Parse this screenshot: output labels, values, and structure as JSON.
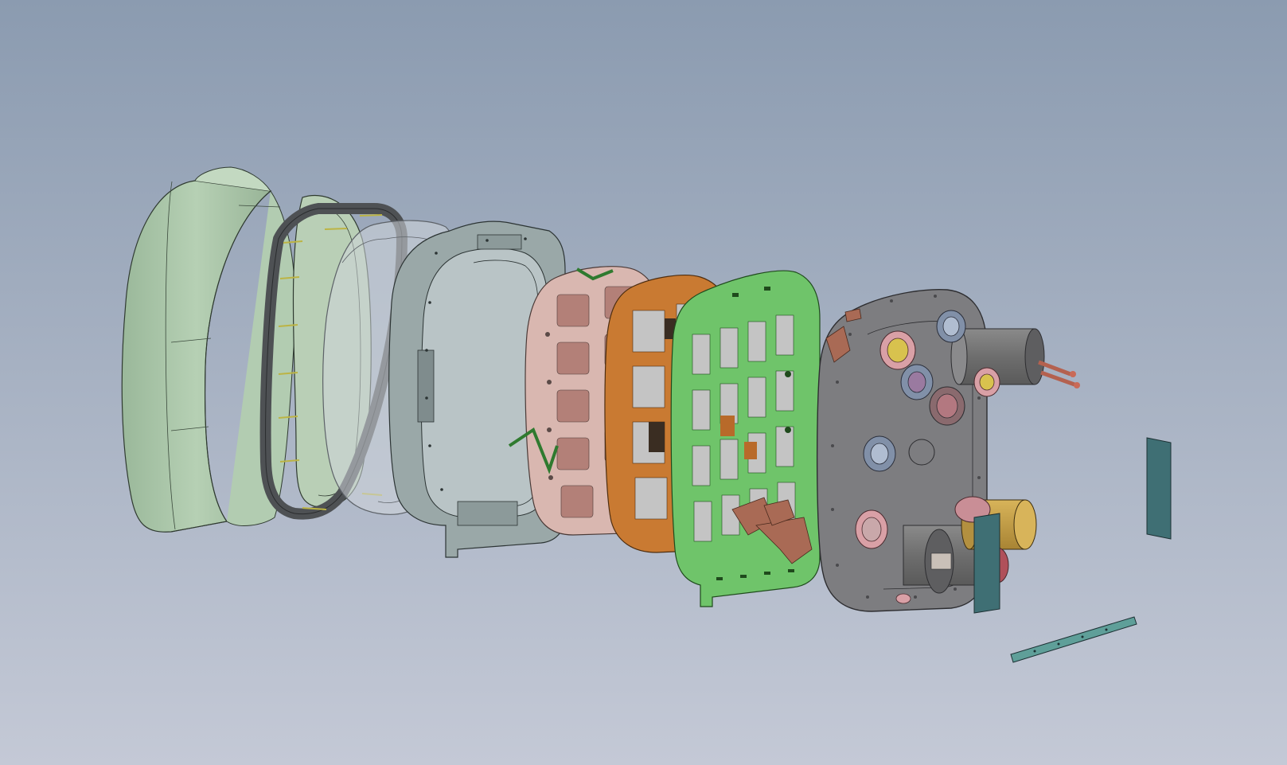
{
  "scene": {
    "kind": "exploded-cad-assembly",
    "view": "isometric",
    "background": {
      "top": "#8b9bb0",
      "bottom": "#c4c9d6"
    },
    "palette": {
      "shell": "#a6c2a6",
      "shell_inner": "#c6dcc4",
      "gasket": "#56595c",
      "clear_ring": "#cfd4d9",
      "frame": "#9aa8a8",
      "pink_plate": "#d9b7b0",
      "copper_frame": "#c97a32",
      "green_board": "#6fc46a",
      "end_plate": "#7d7d80",
      "cylinder_dark": "#737373",
      "cylinder_gold": "#c9a24a",
      "clamp_pink": "#d9a0a6",
      "clamp_blue": "#8190a8",
      "teal_strip": "#3f6f74",
      "teal_flat": "#5f9f99",
      "bolt_yellow": "#c9c24e"
    },
    "parts": [
      {
        "id": "outer-shell",
        "material": "shell"
      },
      {
        "id": "gasket-ring",
        "material": "gasket"
      },
      {
        "id": "transparent-ring",
        "material": "clear_ring"
      },
      {
        "id": "mounting-frame",
        "material": "frame"
      },
      {
        "id": "pink-plate",
        "material": "pink_plate"
      },
      {
        "id": "copper-frame",
        "material": "copper_frame"
      },
      {
        "id": "green-circuit-board",
        "material": "green_board"
      },
      {
        "id": "end-plate",
        "material": "end_plate"
      },
      {
        "id": "vertical-strip-1",
        "material": "teal_strip"
      },
      {
        "id": "vertical-strip-2",
        "material": "teal_strip"
      },
      {
        "id": "flat-strip",
        "material": "teal_flat"
      }
    ]
  }
}
